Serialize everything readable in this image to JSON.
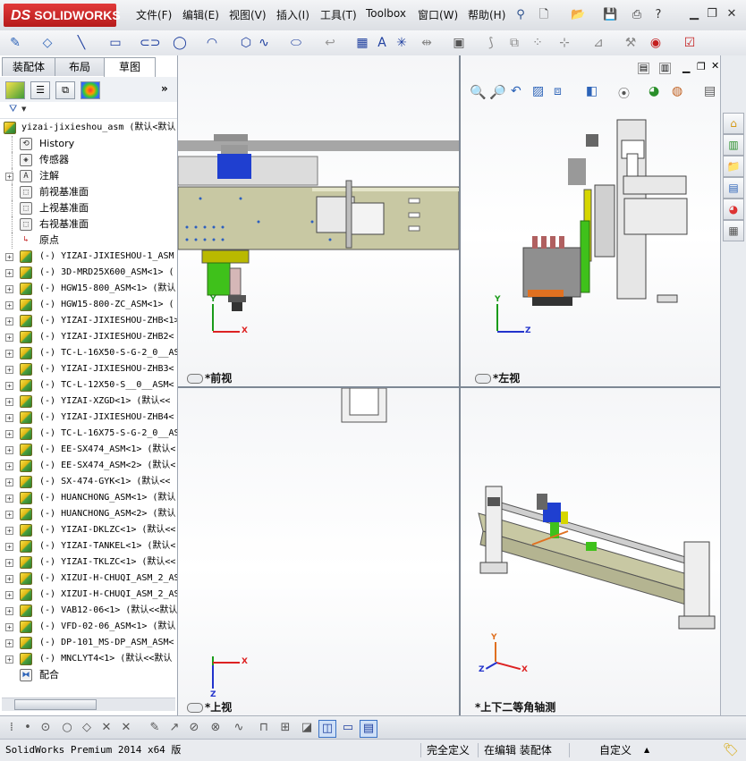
{
  "app": {
    "logo_prefix": "DS",
    "logo_name": "SOLIDWORKS"
  },
  "menu": [
    "文件(F)",
    "编辑(E)",
    "视图(V)",
    "插入(I)",
    "工具(T)",
    "Toolbox",
    "窗口(W)",
    "帮助(H)"
  ],
  "left_tabs": [
    "装配体",
    "布局",
    "草图"
  ],
  "tree": {
    "root": "yizai-jixieshou_asm  (默认<默认",
    "features": [
      {
        "label": "History",
        "icon": "history-icon"
      },
      {
        "label": "传感器",
        "icon": "sensor-icon"
      },
      {
        "label": "注解",
        "icon": "annotation-icon"
      },
      {
        "label": "前视基准面",
        "icon": "plane-icon"
      },
      {
        "label": "上视基准面",
        "icon": "plane-icon"
      },
      {
        "label": "右视基准面",
        "icon": "plane-icon"
      },
      {
        "label": "原点",
        "icon": "origin-icon"
      }
    ],
    "components": [
      "(-) YIZAI-JIXIESHOU-1_ASM",
      "(-) 3D-MRD25X600_ASM<1> (",
      "(-) HGW15-800_ASM<1> (默认",
      "(-) HGW15-800-ZC_ASM<1> (",
      "(-) YIZAI-JIXIESHOU-ZHB<1>",
      "(-) YIZAI-JIXIESHOU-ZHB2<",
      "(-) TC-L-16X50-S-G-2_0__AS",
      "(-) YIZAI-JIXIESHOU-ZHB3<",
      "(-) TC-L-12X50-S__0__ASM<",
      "(-) YIZAI-XZGD<1> (默认<<",
      "(-) YIZAI-JIXIESHOU-ZHB4<",
      "(-) TC-L-16X75-S-G-2_0__AS",
      "(-) EE-SX474_ASM<1> (默认<",
      "(-) EE-SX474_ASM<2> (默认<",
      "(-) SX-474-GYK<1> (默认<<",
      "(-) HUANCHONG_ASM<1> (默认",
      "(-) HUANCHONG_ASM<2> (默认",
      "(-) YIZAI-DKLZC<1> (默认<<",
      "(-) YIZAI-TANKEL<1> (默认<",
      "(-) YIZAI-TKLZC<1> (默认<<",
      "(-) XIZUI-H-CHUQI_ASM_2_AS",
      "(-) XIZUI-H-CHUQI_ASM_2_AS",
      "(-) VAB12-06<1> (默认<<默认",
      "(-) VFD-02-06_ASM<1> (默认",
      "(-) DP-101_MS-DP_ASM_ASM<",
      "(-) MNCLYT4<1> (默认<<默认"
    ],
    "mates": "配合"
  },
  "viewports": {
    "front": "*前视",
    "left": "*左视",
    "top": "*上视",
    "iso": "*上下二等角轴测"
  },
  "status": {
    "product": "SolidWorks Premium 2014 x64 版",
    "defined": "完全定义",
    "editing": "在编辑 装配体",
    "units": "自定义"
  },
  "colors": {
    "plate": "#c8c8a3",
    "green": "#3fc11b",
    "blue_block": "#1f3fd0",
    "grey_part": "#8f8f8f",
    "accent_red": "#c41f1f"
  }
}
